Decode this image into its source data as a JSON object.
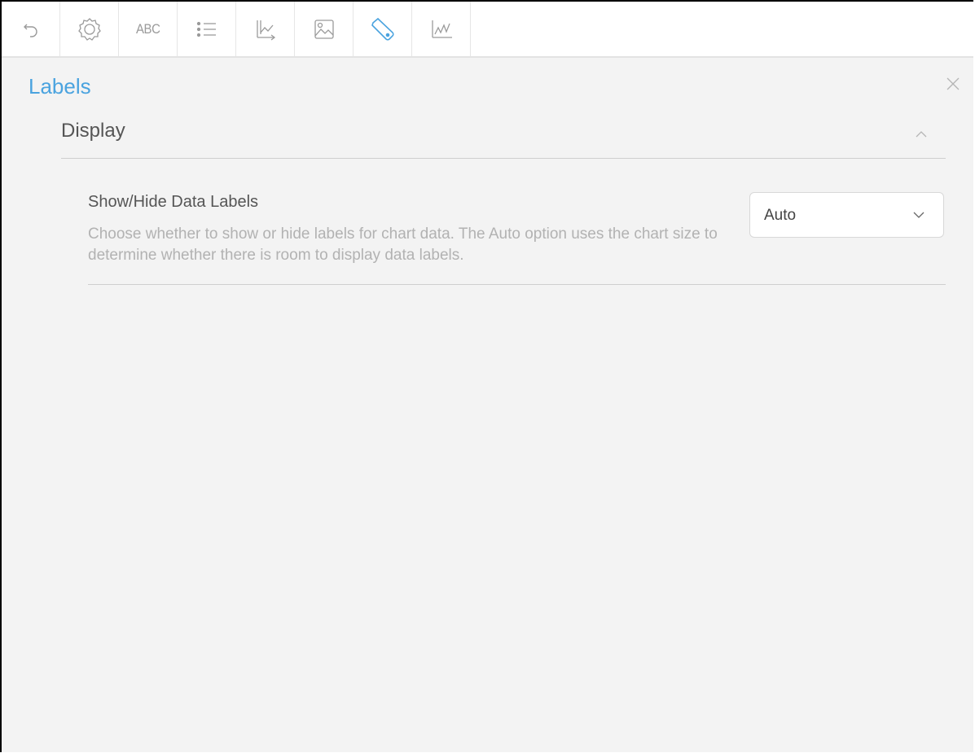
{
  "toolbar": {
    "tools": [
      {
        "icon": "undo-icon"
      },
      {
        "icon": "gear-icon"
      },
      {
        "icon": "abc-text-icon",
        "text": "ABC"
      },
      {
        "icon": "list-icon"
      },
      {
        "icon": "axis-chart-icon"
      },
      {
        "icon": "image-icon"
      },
      {
        "icon": "label-tag-icon",
        "active": true
      },
      {
        "icon": "line-chart-icon"
      }
    ]
  },
  "panel": {
    "title": "Labels",
    "close_icon": "close-icon"
  },
  "section": {
    "title": "Display",
    "collapse_icon": "chevron-up-icon"
  },
  "setting": {
    "label": "Show/Hide Data Labels",
    "description": "Choose whether to show or hide labels for chart data. The Auto option uses the chart size to determine whether there is room to display data labels.",
    "select_value": "Auto",
    "select_icon": "chevron-down-icon"
  },
  "colors": {
    "accent": "#4aa3df",
    "icon_gray": "#9a9a9a",
    "background": "#f3f3f3"
  }
}
